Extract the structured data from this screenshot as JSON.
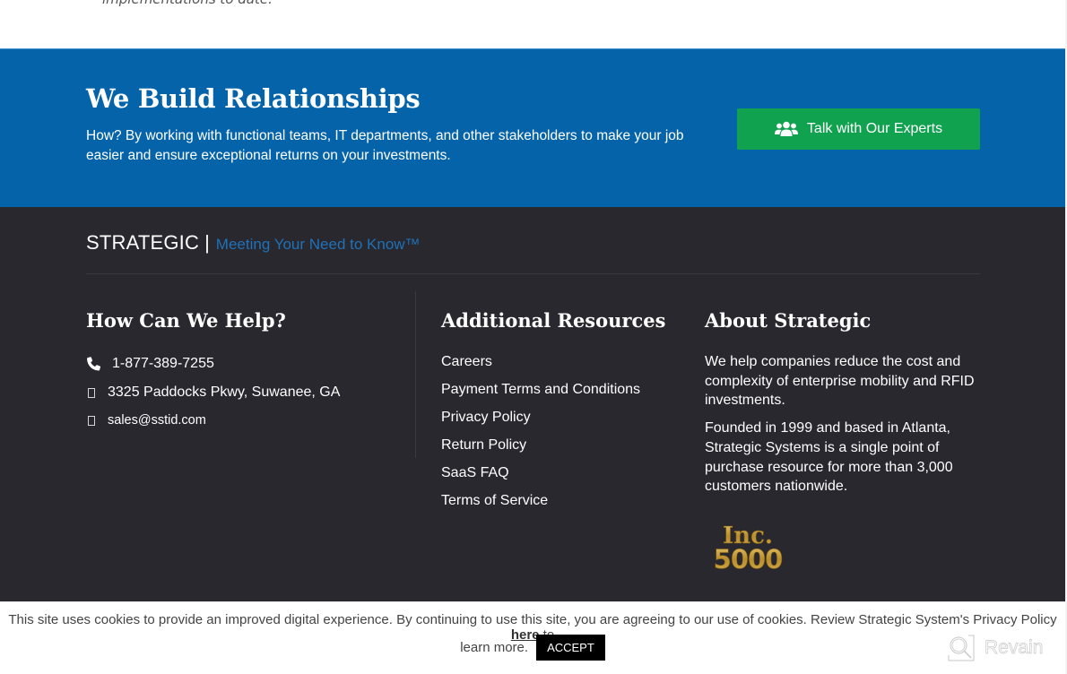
{
  "top": {
    "snippet": "implementations to date."
  },
  "cta": {
    "title": "We Build Relationships",
    "description": "How? By working with functional teams, IT departments, and other stakeholders to make your job easier and ensure exceptional returns on your investments.",
    "button_label": "Talk with Our Experts",
    "button_icon": "users-icon",
    "background_color": "#0563a9",
    "button_color": "#10a24f"
  },
  "footer": {
    "brand_name": "STRATEGIC",
    "brand_separator": "|",
    "tagline": "Meeting Your Need to Know™",
    "tagline_color": "#1f72b8",
    "background_color": "#28282e",
    "help": {
      "title": "How Can We Help?",
      "phone": "1-877-389-7255",
      "address": "3325 Paddocks Pkwy, Suwanee, GA",
      "email": "sales@sstid.com"
    },
    "resources": {
      "title": "Additional Resources",
      "links": [
        "Careers",
        "Payment Terms and Conditions",
        "Privacy Policy",
        "Return Policy",
        "SaaS FAQ",
        "Terms of Service"
      ]
    },
    "about": {
      "title": "About Strategic",
      "paragraphs": [
        "We help companies reduce the cost and complexity of enterprise mobility and RFID investments.",
        "Founded in 1999 and based in Atlanta, Strategic Systems is a single point of purchase resource for more than 3,000 customers nationwide."
      ],
      "badge_line1": "Inc.",
      "badge_line2": "5000"
    }
  },
  "cookie": {
    "text_before": "This site uses cookies to provide an improved digital experience. By continuing to use this site, you are agreeing to our use of cookies. Review Strategic System's Privacy Policy ",
    "link_label": "here",
    "text_after": " to",
    "line2": "learn more.",
    "accept_label": "ACCEPT"
  },
  "watermark": {
    "label": "Revain"
  }
}
